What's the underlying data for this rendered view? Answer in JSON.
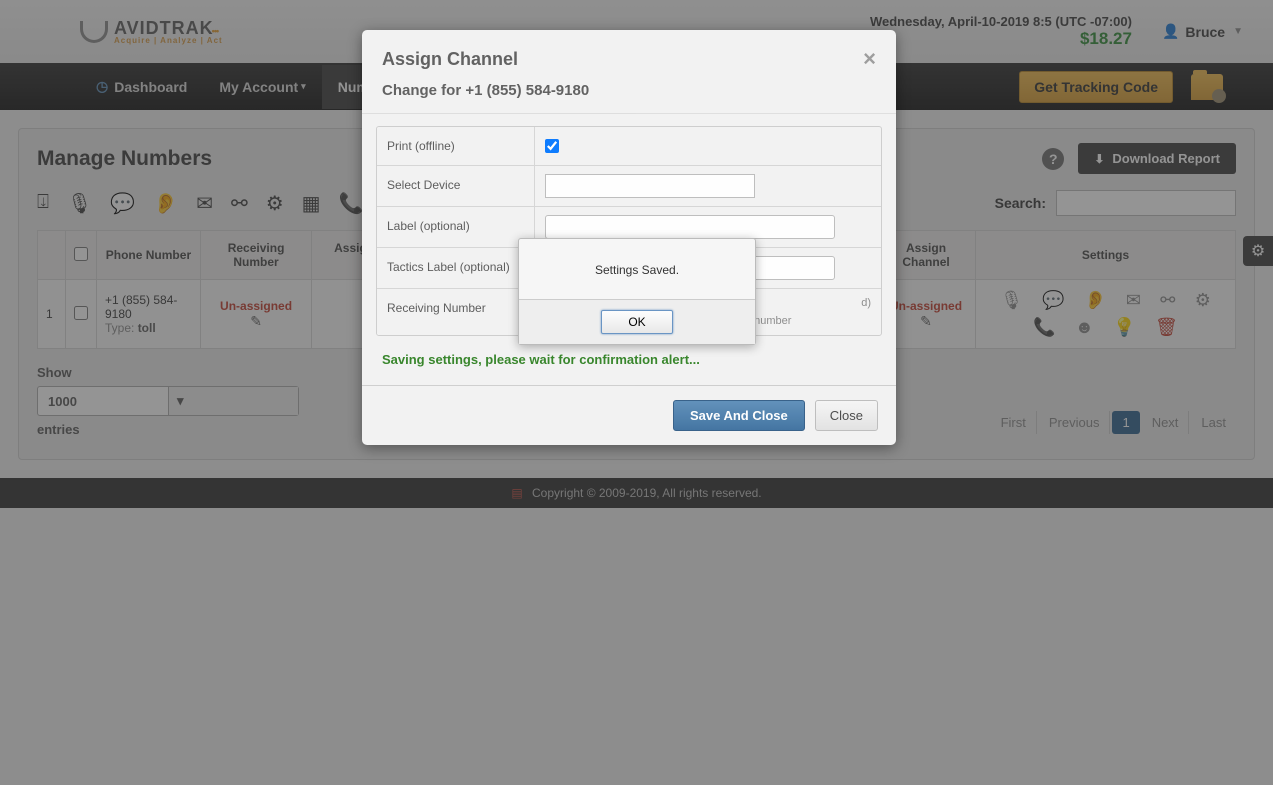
{
  "header": {
    "brand_main": "AVIDTRAK",
    "brand_sub": "Acquire | Analyze | Act",
    "datetime": "Wednesday, April-10-2019 8:5 (UTC -07:00)",
    "balance": "$18.27",
    "user_name": "Bruce"
  },
  "nav": {
    "dashboard": "Dashboard",
    "my_account": "My Account",
    "numbers": "Numbers",
    "get_tracking": "Get Tracking Code"
  },
  "page": {
    "title": "Manage Numbers",
    "download": "Download Report",
    "search_label": "Search:",
    "search_value": ""
  },
  "table": {
    "cols": {
      "num": "",
      "phone": "Phone Number",
      "receiving": "Receiving Number",
      "assign_receiving": "Assign Receiving Number",
      "assign_channel": "Assign Channel",
      "settings": "Settings"
    },
    "row": {
      "idx": "1",
      "phone": "+1 (855) 584-9180",
      "type_label": "Type: ",
      "type_value": "toll",
      "receiving": "Un-assigned",
      "assign_channel": "Un-assigned"
    }
  },
  "show": {
    "label_top": "Show",
    "value": "1000",
    "label_bottom": "entries"
  },
  "pager": {
    "first": "First",
    "prev": "Previous",
    "page": "1",
    "next": "Next",
    "last": "Last"
  },
  "footer": {
    "text": "Copyright © 2009-2019, All rights reserved."
  },
  "modal": {
    "title": "Assign Channel",
    "subtitle": "Change for +1 (855) 584-9180",
    "rows": {
      "print": "Print (offline)",
      "device": "Select Device",
      "label": "Label (optional)",
      "tactics": "Tactics Label (optional)",
      "receiving": "Receiving Number",
      "receiving_hint": "Provide country code for non US receiving number"
    },
    "saving": "Saving settings, please wait for confirmation alert...",
    "save": "Save And Close",
    "close": "Close"
  },
  "confirm": {
    "message": "Settings Saved.",
    "ok": "OK"
  }
}
